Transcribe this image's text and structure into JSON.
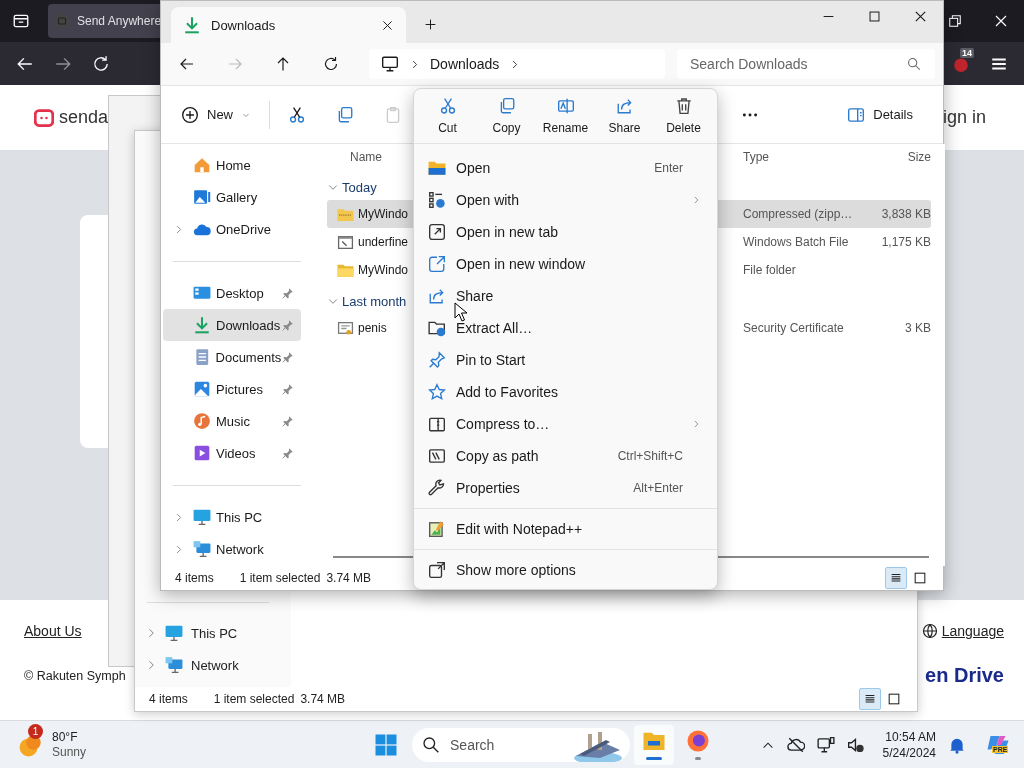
{
  "browser": {
    "tab_title": "Send Anywhere",
    "extension_badge": "14",
    "site": {
      "logo_text": "senda",
      "sign_in": "ign in",
      "about": "About Us",
      "language": "Language",
      "copyright": "© Rakuten Symph",
      "brand": "en Drive"
    }
  },
  "back_window": {
    "sidebar_items": [
      {
        "label": "This PC",
        "kind": "pc"
      },
      {
        "label": "Network",
        "kind": "network"
      }
    ],
    "status": {
      "count": "4 items",
      "selection": "1 item selected",
      "size": "3.74 MB"
    },
    "view_buttons": [
      {
        "kind": "details",
        "selected": true
      },
      {
        "kind": "tiles",
        "selected": false
      }
    ]
  },
  "explorer": {
    "tab": {
      "label": "Downloads"
    },
    "address": {
      "crumbs": [
        "Downloads"
      ]
    },
    "search": {
      "placeholder": "Search Downloads"
    },
    "toolbar": {
      "new_label": "New",
      "details_label": "Details"
    },
    "sidebar": {
      "groups": [
        {
          "items": [
            {
              "label": "Home",
              "kind": "home",
              "expandable": false,
              "pinned": false,
              "selected": false
            },
            {
              "label": "Gallery",
              "kind": "gallery",
              "expandable": false,
              "pinned": false,
              "selected": false
            },
            {
              "label": "OneDrive",
              "kind": "cloud",
              "expandable": true,
              "pinned": false,
              "selected": false
            }
          ]
        },
        {
          "items": [
            {
              "label": "Desktop",
              "kind": "desktop",
              "expandable": false,
              "pinned": true,
              "selected": false
            },
            {
              "label": "Downloads",
              "kind": "download",
              "expandable": false,
              "pinned": true,
              "selected": true
            },
            {
              "label": "Documents",
              "kind": "documents",
              "expandable": false,
              "pinned": true,
              "selected": false
            },
            {
              "label": "Pictures",
              "kind": "pictures",
              "expandable": false,
              "pinned": true,
              "selected": false
            },
            {
              "label": "Music",
              "kind": "music",
              "expandable": false,
              "pinned": true,
              "selected": false
            },
            {
              "label": "Videos",
              "kind": "videos",
              "expandable": false,
              "pinned": true,
              "selected": false
            }
          ]
        },
        {
          "items": [
            {
              "label": "This PC",
              "kind": "pc",
              "expandable": true,
              "pinned": false,
              "selected": false
            },
            {
              "label": "Network",
              "kind": "network",
              "expandable": true,
              "pinned": false,
              "selected": false
            }
          ]
        }
      ]
    },
    "columns": [
      {
        "label": "Name"
      },
      {
        "label": "Type"
      },
      {
        "label": "Size"
      }
    ],
    "groups": [
      {
        "label": "Today",
        "expanded": true,
        "rows": [
          {
            "name": "MyWindo",
            "kind": "zip",
            "type": "Compressed (zipp…",
            "size": "3,838 KB",
            "selected": true
          },
          {
            "name": "underfine",
            "kind": "batch",
            "type": "Windows Batch File",
            "size": "1,175 KB",
            "selected": false
          },
          {
            "name": "MyWindo",
            "kind": "folder",
            "type": "File folder",
            "selected": false
          }
        ]
      },
      {
        "label": "Last month",
        "expanded": true,
        "rows": [
          {
            "name": "penis",
            "kind": "cert",
            "type": "Security Certificate",
            "size": "3 KB",
            "selected": false
          }
        ]
      }
    ],
    "status": {
      "count": "4 items",
      "selection": "1 item selected",
      "size": "3.74 MB"
    },
    "view_buttons": [
      {
        "kind": "details",
        "selected": true
      },
      {
        "kind": "tiles",
        "selected": false
      }
    ]
  },
  "context_menu": {
    "actions": [
      {
        "label": "Cut",
        "kind": "cut"
      },
      {
        "label": "Copy",
        "kind": "copy"
      },
      {
        "label": "Rename",
        "kind": "rename"
      },
      {
        "label": "Share",
        "kind": "share"
      },
      {
        "label": "Delete",
        "kind": "delete"
      }
    ],
    "sections": [
      {
        "items": [
          {
            "label": "Open",
            "kind": "open",
            "shortcut": "Enter",
            "submenu": false
          },
          {
            "label": "Open with",
            "kind": "open_with",
            "submenu": true
          },
          {
            "label": "Open in new tab",
            "kind": "new_tab",
            "submenu": false
          },
          {
            "label": "Open in new window",
            "kind": "new_window",
            "submenu": false
          },
          {
            "label": "Share",
            "kind": "share",
            "submenu": false
          },
          {
            "label": "Extract All…",
            "kind": "extract",
            "submenu": false
          },
          {
            "label": "Pin to Start",
            "kind": "pin",
            "submenu": false
          },
          {
            "label": "Add to Favorites",
            "kind": "star",
            "submenu": false
          },
          {
            "label": "Compress to…",
            "kind": "compress",
            "submenu": true
          },
          {
            "label": "Copy as path",
            "kind": "copy_path",
            "shortcut": "Ctrl+Shift+C",
            "submenu": false
          },
          {
            "label": "Properties",
            "kind": "properties",
            "shortcut": "Alt+Enter",
            "submenu": false
          }
        ]
      },
      {
        "items": [
          {
            "label": "Edit with Notepad++",
            "kind": "notepad",
            "submenu": false
          }
        ]
      },
      {
        "items": [
          {
            "label": "Show more options",
            "kind": "show_more",
            "submenu": false
          }
        ]
      }
    ]
  },
  "taskbar": {
    "weather": {
      "temperature": "80°F",
      "condition": "Sunny",
      "badge": "1"
    },
    "search": {
      "label": "Search"
    },
    "apps": [
      {
        "kind": "explorer",
        "selected": true
      },
      {
        "kind": "firefox",
        "selected": false
      }
    ],
    "copilot_badge": "PRE",
    "clock": {
      "time": "10:54 AM",
      "date": "5/24/2024"
    }
  }
}
